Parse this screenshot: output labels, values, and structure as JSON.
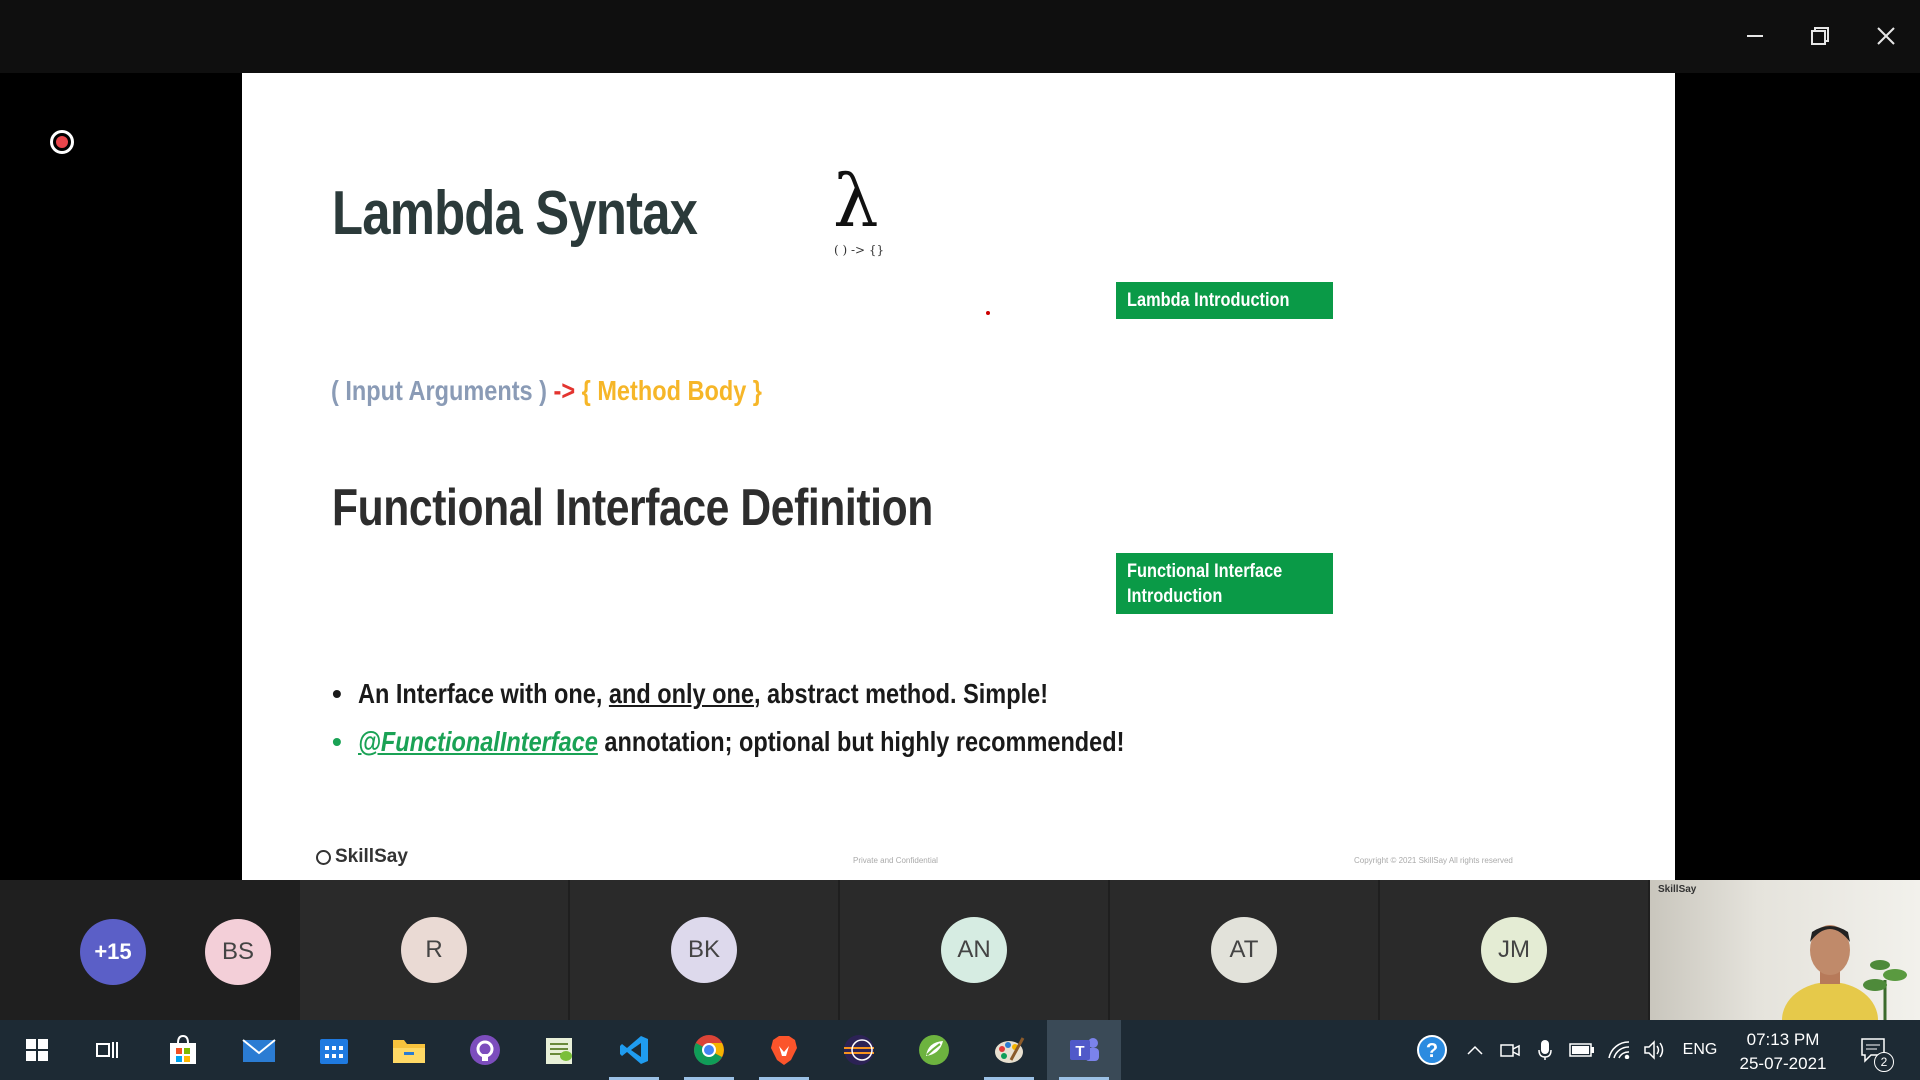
{
  "slide": {
    "title": "Lambda Syntax",
    "lambda_symbol": "λ",
    "lambda_caption": "( ) -> {}",
    "btn_lambda_intro": "Lambda Introduction",
    "syntax": {
      "args": "( Input Arguments )",
      "arrow": " -> ",
      "body": "{ Method Body }"
    },
    "subtitle": "Functional Interface Definition",
    "btn_fi_line1": "Functional Interface",
    "btn_fi_line2": "Introduction",
    "bullet1": {
      "before": "An Interface with one, ",
      "underlined": "and only one",
      "after": ", abstract method. Simple!"
    },
    "bullet2": {
      "link": "@FunctionalInterface",
      "after": " annotation; optional but highly recommended!"
    },
    "footer_logo": "SkillSay",
    "footer_center": "Private and Confidential",
    "footer_right": "Copyright © 2021 SkillSay All rights reserved"
  },
  "participants": {
    "more": "+15",
    "list": [
      {
        "initials": "BS",
        "bg": "#f3cfd8"
      },
      {
        "initials": "R",
        "bg": "#eadad4"
      },
      {
        "initials": "BK",
        "bg": "#ddd9ec"
      },
      {
        "initials": "AN",
        "bg": "#d6ece2"
      },
      {
        "initials": "AT",
        "bg": "#e2e2da"
      },
      {
        "initials": "JM",
        "bg": "#e4ecd4"
      }
    ],
    "video_label": "SkillSay"
  },
  "taskbar": {
    "language": "ENG",
    "time": "07:13 PM",
    "date": "25-07-2021",
    "notifications": "2"
  },
  "colors": {
    "accent_green": "#0a9a47",
    "teams_purple": "#5b5fc7",
    "record_red": "#e8454b"
  }
}
